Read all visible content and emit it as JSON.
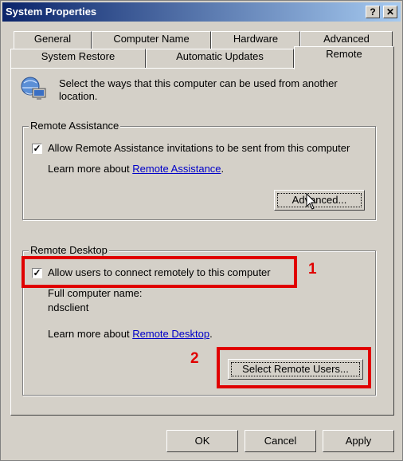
{
  "window": {
    "title": "System Properties",
    "help_btn": "?",
    "close_btn": "✕"
  },
  "tabs_row1": [
    "General",
    "Computer Name",
    "Hardware",
    "Advanced"
  ],
  "tabs_row2": [
    "System Restore",
    "Automatic Updates",
    "Remote"
  ],
  "intro": {
    "line1": "Select the ways that this computer can be used from another",
    "line2": "location."
  },
  "remote_assistance": {
    "group_label": "Remote Assistance",
    "checkbox_label": "Allow Remote Assistance invitations to be sent from this computer",
    "checked": true,
    "learn_prefix": "Learn more about",
    "learn_link": "Remote Assistance",
    "learn_suffix": ".",
    "advanced_button": "Advanced..."
  },
  "remote_desktop": {
    "group_label": "Remote Desktop",
    "checkbox_label": "Allow users to connect remotely to this computer",
    "checked": true,
    "computer_name_label": "Full computer name:",
    "computer_name": "ndsclient",
    "learn_prefix": "Learn more about",
    "learn_link": "Remote Desktop",
    "learn_suffix": ".",
    "select_users_button": "Select Remote Users..."
  },
  "annotations": {
    "one": "1",
    "two": "2"
  },
  "footer": {
    "ok": "OK",
    "cancel": "Cancel",
    "apply": "Apply"
  },
  "colors": {
    "highlight": "#e00000",
    "titlebar": "#0a246a",
    "link": "#0000c8"
  },
  "icons": {
    "intro_icon": "remote-computer-icon"
  }
}
